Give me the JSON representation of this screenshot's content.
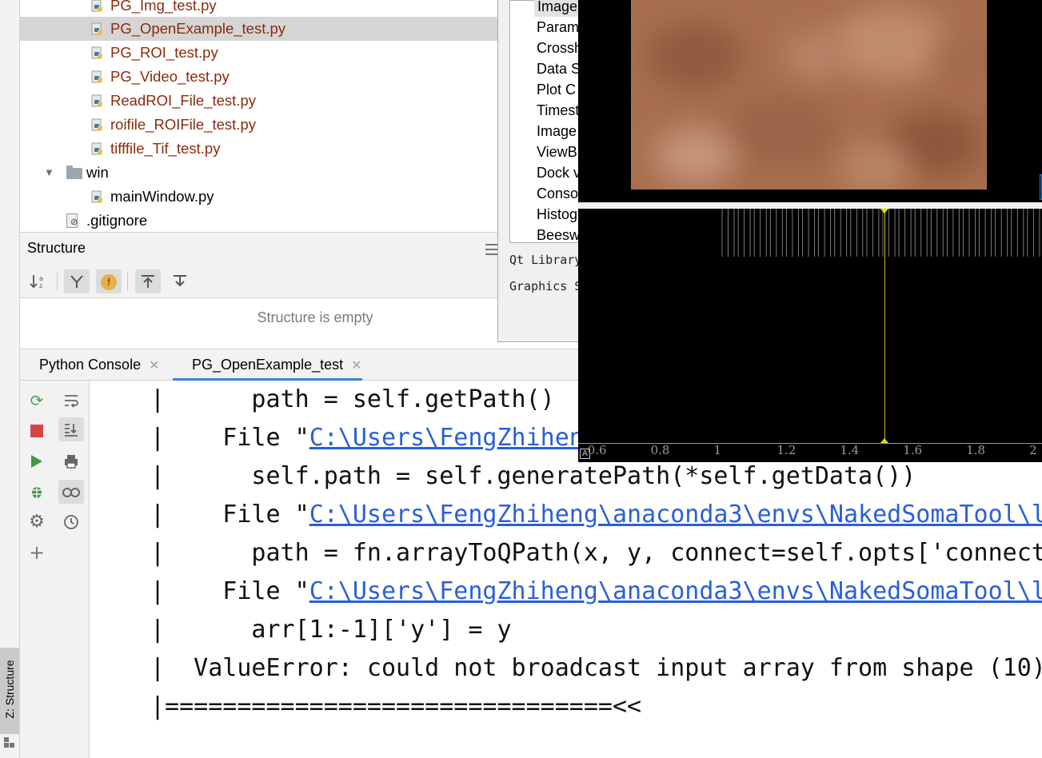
{
  "project_tree": {
    "items": [
      {
        "label": "PG_Img_test.py",
        "type": "python-file"
      },
      {
        "label": "PG_OpenExample_test.py",
        "type": "python-file",
        "selected": true
      },
      {
        "label": "PG_ROI_test.py",
        "type": "python-file"
      },
      {
        "label": "PG_Video_test.py",
        "type": "python-file"
      },
      {
        "label": "ReadROI_File_test.py",
        "type": "python-file"
      },
      {
        "label": "roifile_ROIFile_test.py",
        "type": "python-file"
      },
      {
        "label": "tifffile_Tif_test.py",
        "type": "python-file"
      },
      {
        "label": "win",
        "type": "folder",
        "expanded": true
      },
      {
        "label": "mainWindow.py",
        "type": "python-file"
      },
      {
        "label": ".gitignore",
        "type": "ignored-file"
      }
    ]
  },
  "structure_panel": {
    "title": "Structure",
    "empty_text": "Structure is empty",
    "field_icon_letter": "f"
  },
  "examples_window": {
    "items": [
      "Image",
      "Param",
      "Crossh",
      "Data S",
      "Plot C",
      "Timest",
      "Image",
      "ViewB",
      "Dock v",
      "Conso",
      "Histog",
      "Beesw"
    ],
    "qt_library_label": "Qt Library",
    "graphics_label": "Graphics S"
  },
  "console_tabs": [
    {
      "label": "Python Console",
      "active": false
    },
    {
      "label": "PG_OpenExample_test",
      "active": true
    }
  ],
  "console_output": {
    "lines": [
      {
        "prefix": "|      path = self.getPath()",
        "link": "",
        "suffix": ""
      },
      {
        "prefix": "|    File \"",
        "link": "C:\\Users\\FengZhihen",
        "suffix": ""
      },
      {
        "prefix": "|      self.path = self.generatePath(*self.getData())",
        "link": "",
        "suffix": ""
      },
      {
        "prefix": "|    File \"",
        "link": "C:\\Users\\FengZhiheng\\anaconda3\\envs\\NakedSomaTool\\l",
        "suffix": ""
      },
      {
        "prefix": "|      path = fn.arrayToQPath(x, y, connect=self.opts['connect",
        "link": "",
        "suffix": ""
      },
      {
        "prefix": "|    File \"",
        "link": "C:\\Users\\FengZhiheng\\anaconda3\\envs\\NakedSomaTool\\l",
        "suffix": ""
      },
      {
        "prefix": "|      arr[1:-1]['y'] = y",
        "link": "",
        "suffix": ""
      },
      {
        "prefix": "|  ValueError: could not broadcast input array from shape (10)",
        "link": "",
        "suffix": ""
      },
      {
        "prefix": "|===============================<<",
        "link": "",
        "suffix": ""
      }
    ]
  },
  "plot_window": {
    "x_tick_labels": [
      "0.6",
      "0.8",
      "1",
      "1.2",
      "1.4",
      "1.6",
      "1.8",
      "2"
    ],
    "x_range": [
      0.55,
      2.02
    ],
    "infinite_line_x": 1.52,
    "auto_range_button": "A",
    "image_color": "#a86f4f",
    "line_color": "#c7c000"
  },
  "left_strip": {
    "structure_tab_label": "Z: Structure"
  }
}
